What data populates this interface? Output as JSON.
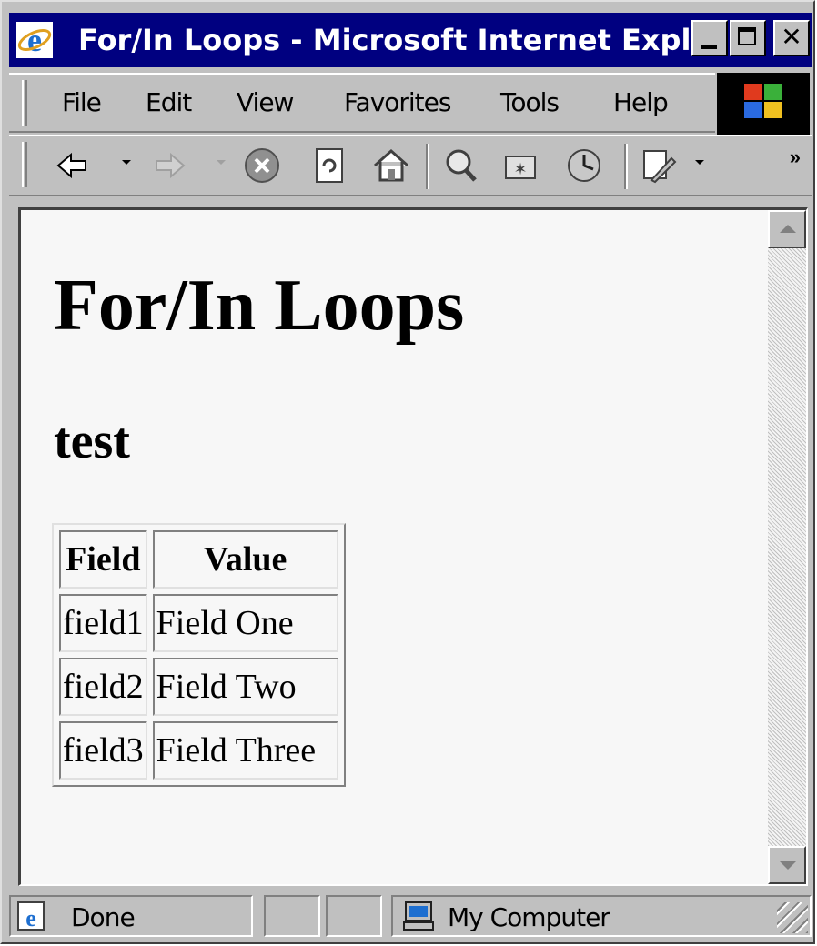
{
  "window": {
    "title": "For/In Loops - Microsoft Internet Expl...",
    "buttons": {
      "minimize": "minimize-icon",
      "maximize": "maximize-icon",
      "close": "close-icon",
      "close_glyph": "✕"
    }
  },
  "menubar": {
    "items": [
      "File",
      "Edit",
      "View",
      "Favorites",
      "Tools",
      "Help"
    ]
  },
  "toolbar": {
    "buttons": [
      "back-icon",
      "forward-icon",
      "stop-icon",
      "refresh-icon",
      "home-icon",
      "search-icon",
      "favorites-icon",
      "history-icon",
      "edit-icon"
    ],
    "overflow": "»"
  },
  "page": {
    "heading": "For/In Loops",
    "subheading": "test",
    "table": {
      "headers": [
        "Field",
        "Value"
      ],
      "rows": [
        [
          "field1",
          "Field One"
        ],
        [
          "field2",
          "Field Two"
        ],
        [
          "field3",
          "Field Three"
        ]
      ]
    }
  },
  "statusbar": {
    "status": "Done",
    "zone": "My Computer"
  },
  "colors": {
    "titlebar": "#000080",
    "chrome": "#c0c0c0",
    "page_bg": "#f7f7f7"
  }
}
